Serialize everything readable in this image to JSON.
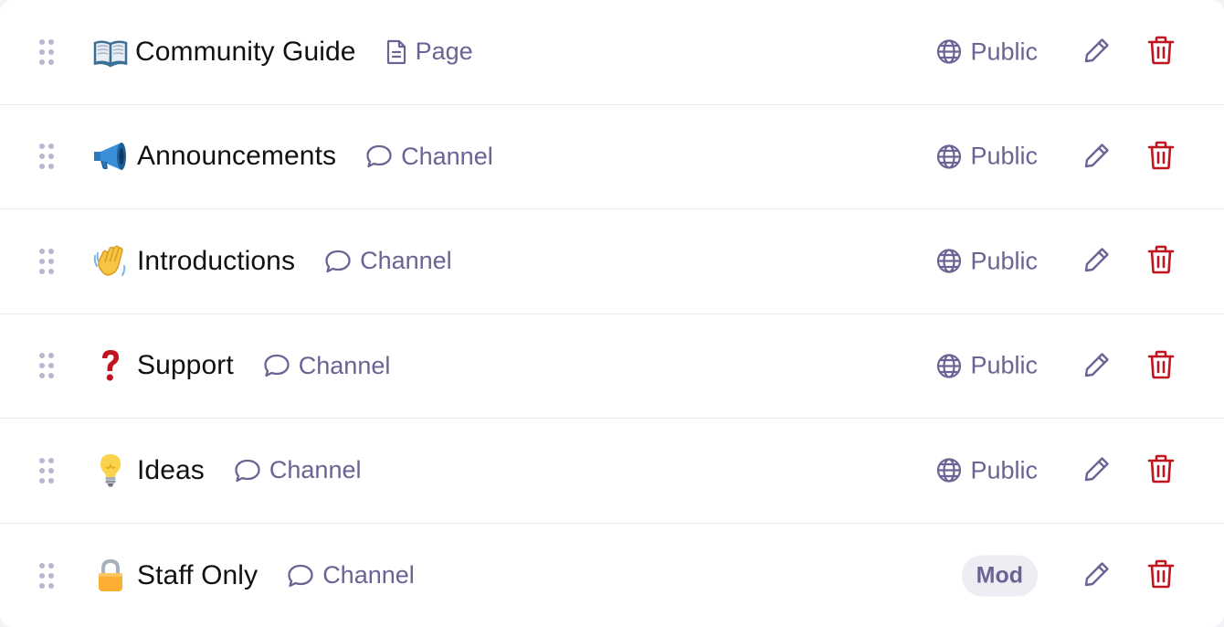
{
  "colors": {
    "accent": "#6a6394",
    "danger": "#c0141f",
    "drag_handle": "#b9b6cf",
    "text": "#111111",
    "badge_bg": "#eeedf4"
  },
  "items": [
    {
      "name": "Community Guide",
      "emoji": "open-book",
      "type_label": "Page",
      "type_icon": "page-icon",
      "visibility": "Public",
      "badge": null
    },
    {
      "name": "Announcements",
      "emoji": "megaphone",
      "type_label": "Channel",
      "type_icon": "chat-bubble-icon",
      "visibility": "Public",
      "badge": null
    },
    {
      "name": "Introductions",
      "emoji": "waving-hand",
      "type_label": "Channel",
      "type_icon": "chat-bubble-icon",
      "visibility": "Public",
      "badge": null
    },
    {
      "name": "Support",
      "emoji": "question-mark",
      "type_label": "Channel",
      "type_icon": "chat-bubble-icon",
      "visibility": "Public",
      "badge": null
    },
    {
      "name": "Ideas",
      "emoji": "light-bulb",
      "type_label": "Channel",
      "type_icon": "chat-bubble-icon",
      "visibility": "Public",
      "badge": null
    },
    {
      "name": "Staff Only",
      "emoji": "lock",
      "type_label": "Channel",
      "type_icon": "chat-bubble-icon",
      "visibility": null,
      "badge": "Mod"
    }
  ]
}
